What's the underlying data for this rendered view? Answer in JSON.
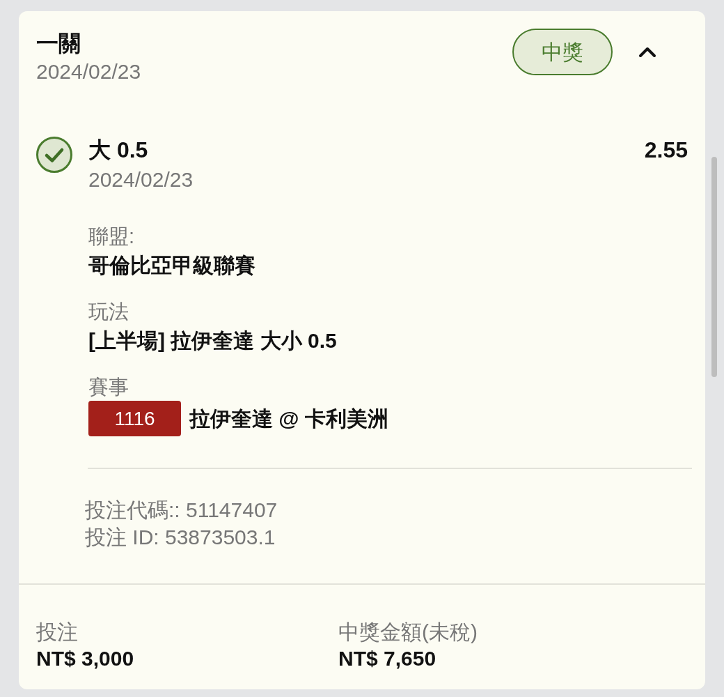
{
  "bet": {
    "title": "一關",
    "date": "2024/02/23",
    "status": {
      "label": "中獎",
      "kind": "won"
    },
    "expanded": true,
    "selection": {
      "won": true,
      "pick": "大 0.5",
      "odds": "2.55",
      "date": "2024/02/23"
    },
    "details": [
      {
        "label": "聯盟:",
        "value": "哥倫比亞甲級聯賽"
      },
      {
        "label": "玩法",
        "value": "[上半場] 拉伊奎達 大小 0.5"
      },
      {
        "label": "賽事",
        "match_id": "1116",
        "value": "拉伊奎達 @ 卡利美洲"
      }
    ],
    "references": [
      "投注代碼:: 51147407",
      "投注 ID: 53873503.1"
    ],
    "totals": [
      {
        "label": "投注",
        "amount": "NT$ 3,000"
      },
      {
        "label": "中獎金額(未稅)",
        "amount": "NT$ 7,650"
      }
    ]
  }
}
